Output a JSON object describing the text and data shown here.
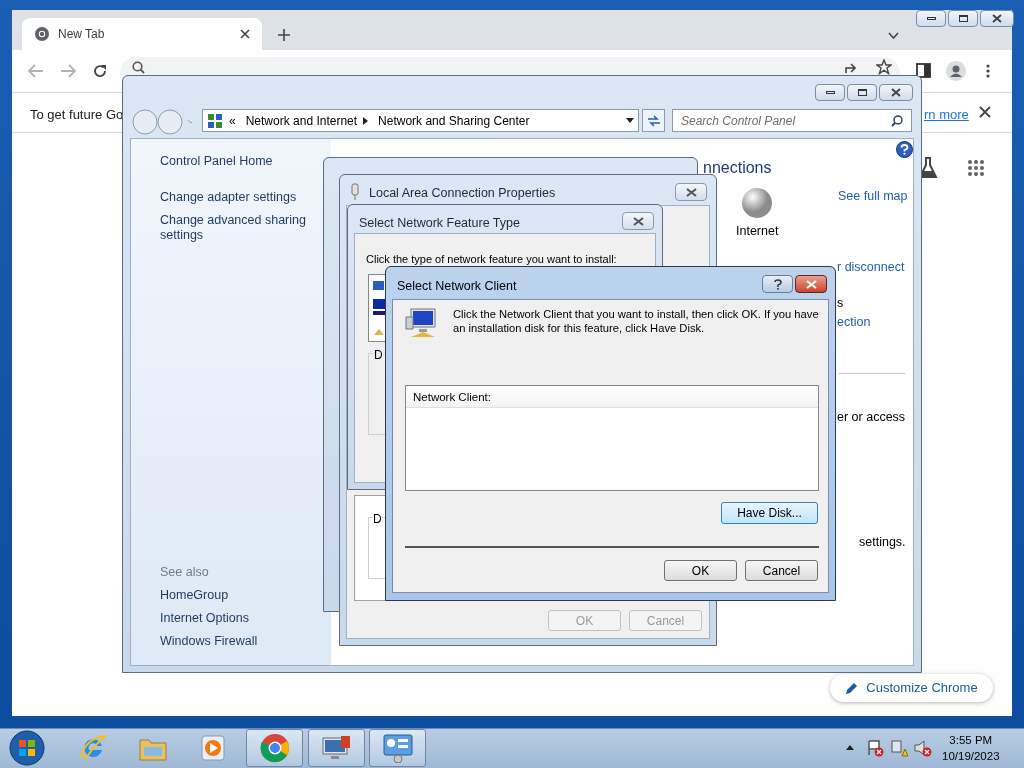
{
  "chrome": {
    "tabs": [
      {
        "title": "New Tab",
        "selected": true
      }
    ],
    "infobar": {
      "text": "To get future Go",
      "link": "rn more"
    },
    "customize_button": "Customize Chrome"
  },
  "control_panel": {
    "overflow": "«",
    "breadcrumbs": [
      "Network and Internet",
      "Network and Sharing Center"
    ],
    "search": {
      "placeholder": "Search Control Panel"
    },
    "tasks": [
      "Control Panel Home",
      "Change adapter settings",
      "Change advanced sharing settings"
    ],
    "see_also": {
      "heading": "See also",
      "links": [
        "HomeGroup",
        "Internet Options",
        "Windows Firewall"
      ]
    },
    "heading": "nnections",
    "map": {
      "node": "Internet",
      "link": "See full map"
    },
    "fragments": [
      {
        "text": "r disconnect",
        "kind": "link"
      },
      {
        "text": "s",
        "kind": "text"
      },
      {
        "text": "ection",
        "kind": "link"
      },
      {
        "text": "er or access",
        "kind": "text"
      },
      {
        "text": "settings.",
        "kind": "text"
      }
    ]
  },
  "properties_dialog": {
    "title": "Local Area Connection Properties",
    "fragments": [
      "D"
    ],
    "buttons": [
      {
        "label": "OK",
        "disabled": true
      },
      {
        "label": "Cancel",
        "disabled": true
      }
    ]
  },
  "feature_dialog": {
    "title": "Select Network Feature Type",
    "prompt": "Click the type of network feature you want to install:",
    "fragments": [
      "D"
    ]
  },
  "client_dialog": {
    "title": "Select Network Client",
    "message": "Click the Network Client that you want to install, then click OK. If you have an installation disk for this feature, click Have Disk.",
    "list_header": "Network Client:",
    "have_disk": {
      "label": "Have Disk...",
      "disabled": false
    },
    "buttons": [
      {
        "label": "OK",
        "disabled": false
      },
      {
        "label": "Cancel",
        "disabled": false
      }
    ]
  },
  "taskbar": {
    "items": [
      {
        "kind": "ie",
        "active": false
      },
      {
        "kind": "explorer",
        "active": false
      },
      {
        "kind": "media",
        "active": false
      },
      {
        "kind": "chrome",
        "active": true
      },
      {
        "kind": "remote",
        "active": true
      },
      {
        "kind": "control_panel",
        "active": true
      }
    ],
    "clock": {
      "time": "3:55 PM",
      "date": "10/19/2023"
    }
  }
}
